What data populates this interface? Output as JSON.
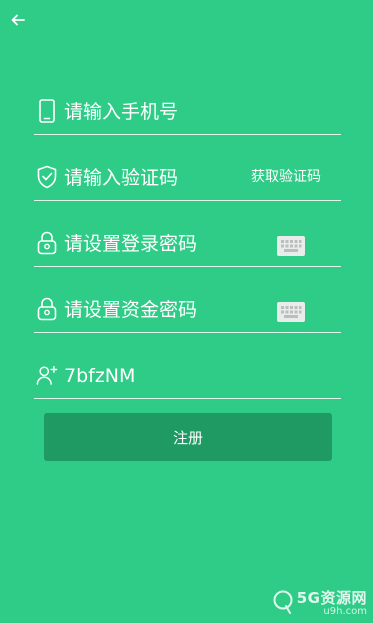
{
  "header": {
    "back_icon": "arrow-left-icon"
  },
  "form": {
    "phone": {
      "icon": "phone-icon",
      "placeholder": "请输入手机号",
      "value": ""
    },
    "code": {
      "icon": "shield-check-icon",
      "placeholder": "请输入验证码",
      "value": "",
      "button_label": "获取验证码"
    },
    "login_password": {
      "icon": "lock-icon",
      "placeholder": "请设置登录密码",
      "value": "",
      "keyboard_icon": "keyboard-icon"
    },
    "fund_password": {
      "icon": "lock-icon",
      "placeholder": "请设置资金密码",
      "value": "",
      "keyboard_icon": "keyboard-icon"
    },
    "invite": {
      "icon": "add-user-icon",
      "value": "7bfzNM"
    }
  },
  "submit_label": "注册",
  "watermark": {
    "brand": "5G资源网",
    "domain": "u9h.com"
  },
  "colors": {
    "background": "#2fcc88",
    "button": "#1f9a63",
    "text": "#ffffff"
  }
}
